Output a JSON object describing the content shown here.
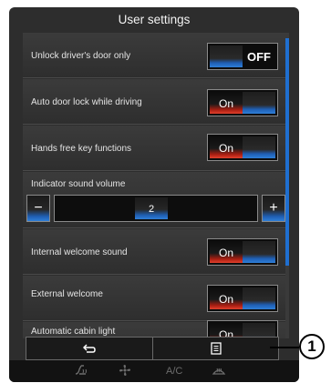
{
  "header": {
    "title": "User settings"
  },
  "settings": [
    {
      "label": "Unlock driver's door only",
      "type": "toggle",
      "state": "OFF"
    },
    {
      "label": "Auto door lock while driving",
      "type": "toggle",
      "state": "On"
    },
    {
      "label": "Hands free key functions",
      "type": "toggle",
      "state": "On"
    },
    {
      "label": "Indicator sound volume",
      "type": "stepper",
      "value": "2",
      "minus": "−",
      "plus": "+"
    },
    {
      "label": "Internal welcome sound",
      "type": "toggle",
      "state": "On"
    },
    {
      "label": "External welcome",
      "type": "toggle",
      "state": "On"
    },
    {
      "label": "Automatic cabin light",
      "type": "toggle",
      "state": "On"
    }
  ],
  "bottom_bar": {
    "back_icon": "return-arrow-icon",
    "menu_icon": "list-menu-icon"
  },
  "climate_bar": {
    "ac_label": "A/C"
  },
  "callout": {
    "number": "1"
  },
  "colors": {
    "accent_blue": "#2f7fd8",
    "on_red": "#e2402c",
    "background": "#2d2d2d"
  }
}
